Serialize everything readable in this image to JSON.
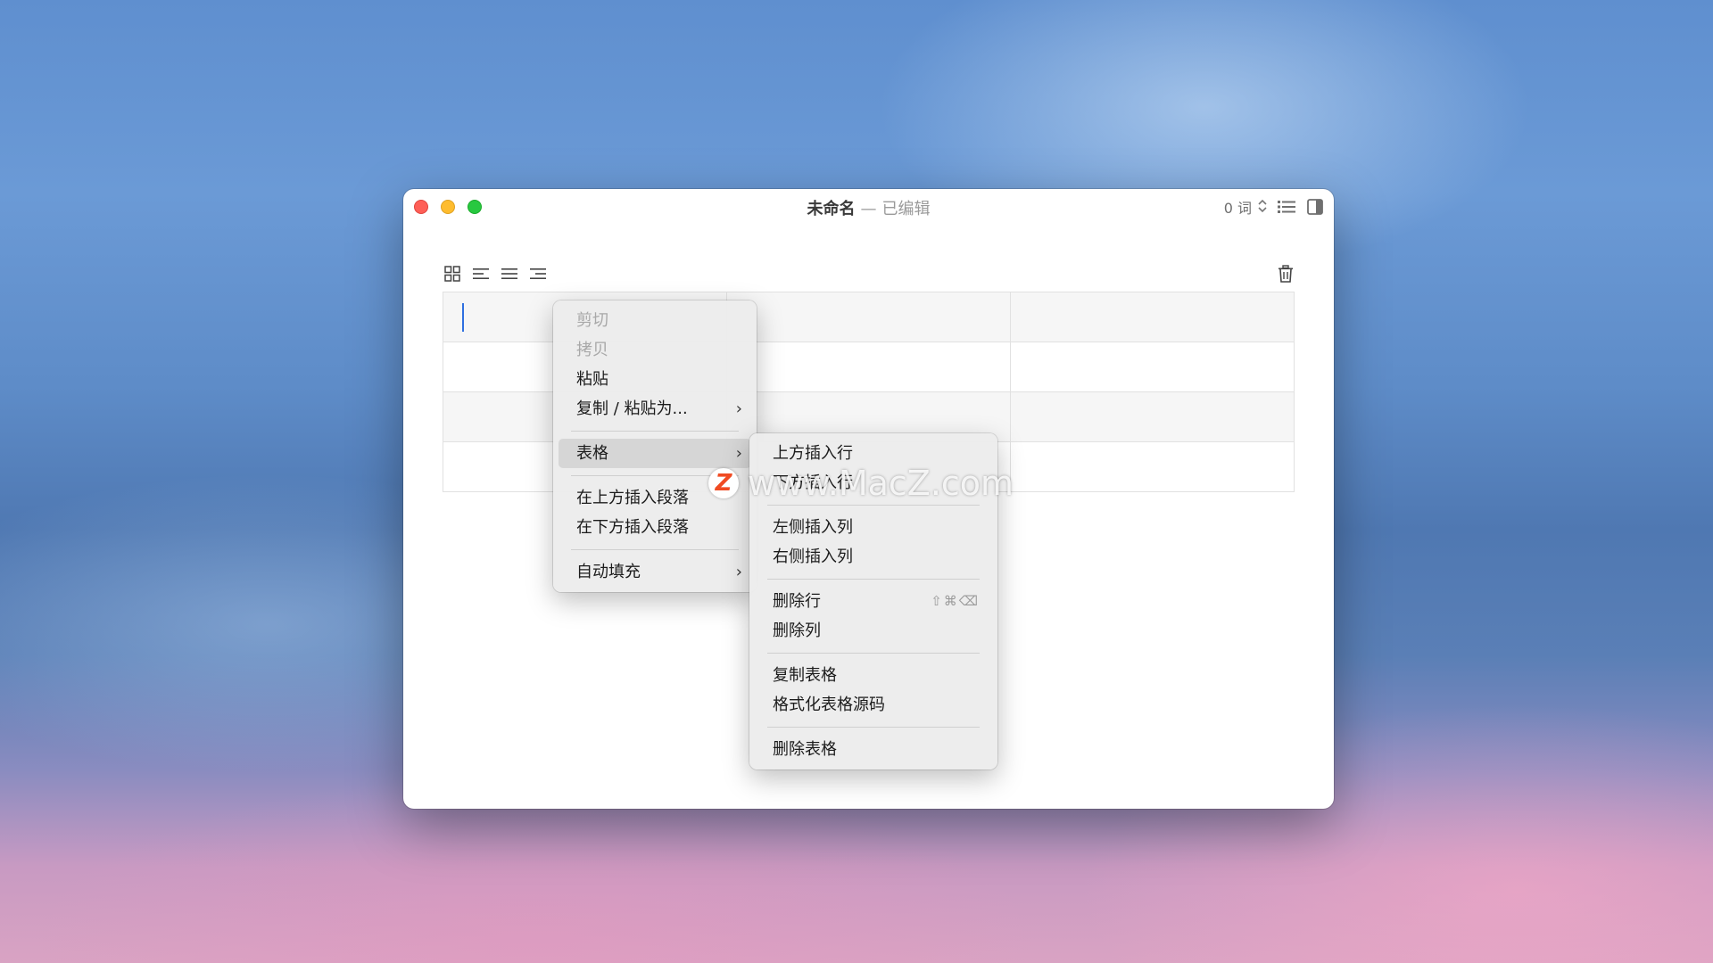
{
  "window": {
    "title": "未命名",
    "title_separator": "—",
    "status": "已编辑",
    "word_count": "0 词"
  },
  "table": {
    "rows": 4,
    "columns": 3
  },
  "context_menu": {
    "items": [
      {
        "label": "剪切",
        "disabled": true
      },
      {
        "label": "拷贝",
        "disabled": true
      },
      {
        "label": "粘贴",
        "disabled": false
      },
      {
        "label": "复制 / 粘贴为...",
        "submenu": true
      },
      {
        "label": "表格",
        "submenu": true,
        "active": true
      },
      {
        "label": "在上方插入段落"
      },
      {
        "label": "在下方插入段落"
      },
      {
        "label": "自动填充",
        "submenu": true
      }
    ]
  },
  "table_submenu": {
    "items": [
      {
        "label": "上方插入行"
      },
      {
        "label": "下方插入行"
      },
      {
        "label": "左侧插入列"
      },
      {
        "label": "右侧插入列"
      },
      {
        "label": "删除行",
        "shortcut": "⇧⌘⌫"
      },
      {
        "label": "删除列"
      },
      {
        "label": "复制表格"
      },
      {
        "label": "格式化表格源码"
      },
      {
        "label": "删除表格"
      }
    ]
  },
  "watermark": {
    "badge": "Z",
    "text": "www.MacZ.com"
  },
  "colors": {
    "close": "#fe5f57",
    "minimize": "#febc2e",
    "zoom": "#28c840",
    "caret": "#2f6fe0",
    "watermark_badge": "#f04b23"
  }
}
